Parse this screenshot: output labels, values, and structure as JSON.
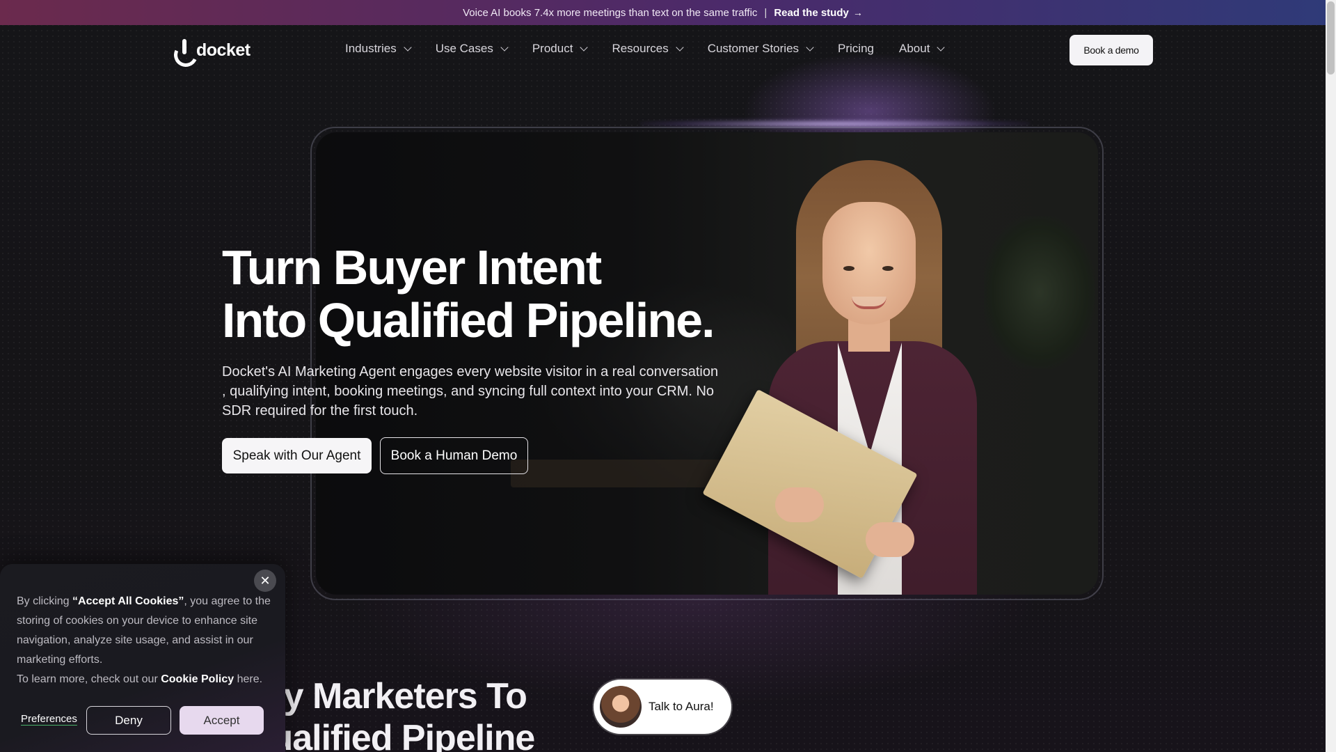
{
  "announcement": {
    "text": "Voice AI books 7.4x more meetings than text on the same traffic",
    "separator": "|",
    "link_label": "Read the study",
    "link_arrow": "→"
  },
  "nav": {
    "logo_text": "docket",
    "items": [
      {
        "label": "Industries",
        "has_dropdown": true
      },
      {
        "label": "Use Cases",
        "has_dropdown": true
      },
      {
        "label": "Product",
        "has_dropdown": true
      },
      {
        "label": "Resources",
        "has_dropdown": true
      },
      {
        "label": "Customer Stories",
        "has_dropdown": true
      },
      {
        "label": "Pricing",
        "has_dropdown": false
      },
      {
        "label": "About",
        "has_dropdown": true
      }
    ],
    "cta_label": "Book a demo"
  },
  "hero": {
    "title_line1": "Turn Buyer Intent",
    "title_line2": "Into Qualified Pipeline.",
    "subtitle": "Docket's AI Marketing Agent engages every website visitor in a real conversation , qualifying intent, booking meetings, and syncing full context into your CRM. No SDR required for the first touch.",
    "primary_cta": "Speak with Our Agent",
    "secondary_cta": "Book a Human Demo"
  },
  "section2": {
    "title_line1": "l by Marketers To",
    "title_line2": "Qualified Pipeline"
  },
  "aura_widget": {
    "label": "Talk to Aura!"
  },
  "cookie_banner": {
    "text_before": "By clicking ",
    "text_bold": "“Accept All Cookies”",
    "text_after": ", you agree to the storing of cookies on your device to enhance site navigation, analyze site usage, and assist in our marketing efforts.",
    "learn_before": "To learn more, check out our ",
    "learn_bold": "Cookie Policy",
    "learn_after": " here.",
    "close_symbol": "✕",
    "preferences_label": "Preferences",
    "deny_label": "Deny",
    "accept_label": "Accept"
  },
  "colors": {
    "page_bg": "#131316",
    "announce_start": "#6b2a4d",
    "announce_end": "#2f3a78",
    "button_light": "#f6f5f7",
    "accept_bg": "#e7d9ee",
    "preferences_underline": "#4ab36b"
  },
  "icons": {
    "logo": "docket-logo-icon",
    "dropdown": "chevron-down-icon",
    "close": "close-icon",
    "arrow": "arrow-right-icon"
  }
}
